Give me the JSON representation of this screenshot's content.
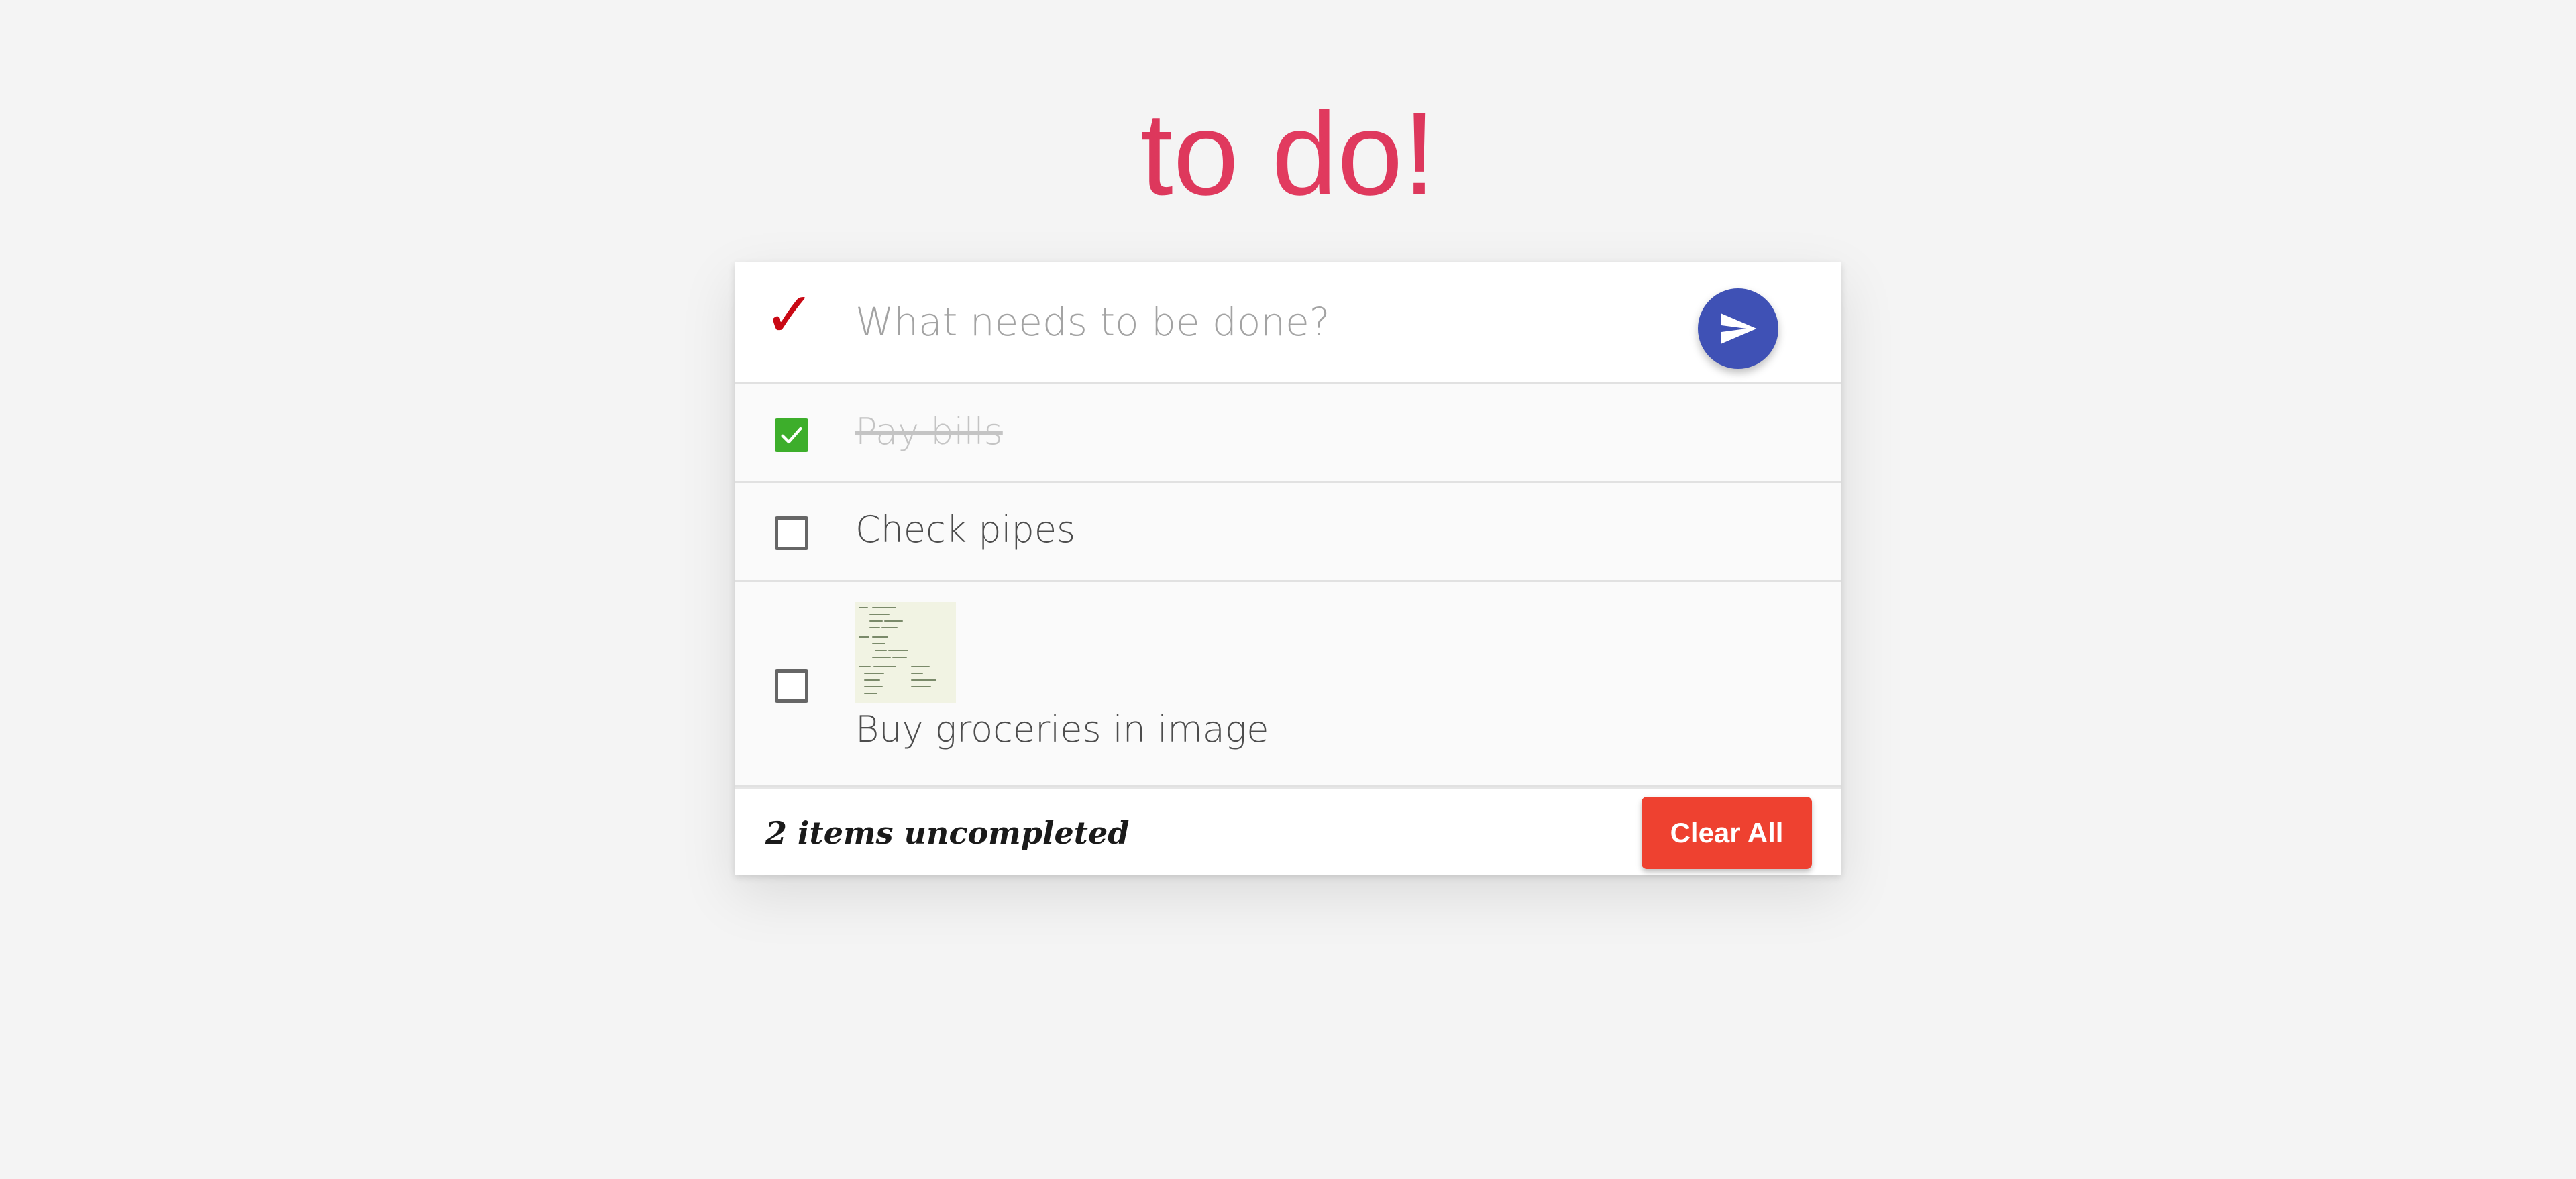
{
  "app": {
    "title": "to do!",
    "title_color": "#c0244a"
  },
  "input": {
    "toggle_icon": "checkmark-icon",
    "toggle_glyph": "✓",
    "placeholder": "What needs to be done?",
    "value": "",
    "send_icon": "send-icon",
    "send_color": "#3f51b5"
  },
  "todos": [
    {
      "label": "Pay bills",
      "completed": true,
      "has_image": false
    },
    {
      "label": "Check pipes",
      "completed": false,
      "has_image": true
    },
    {
      "label": "Buy groceries in image",
      "completed": false,
      "has_image": true,
      "image_icon": "grocery-list-thumbnail"
    }
  ],
  "footer": {
    "count_text": "2 items uncompleted",
    "clear_label": "Clear All",
    "clear_color": "#ee4130"
  },
  "colors": {
    "background": "#f4f4f4",
    "checked": "#3dae2b",
    "toggle": "#c90814"
  }
}
